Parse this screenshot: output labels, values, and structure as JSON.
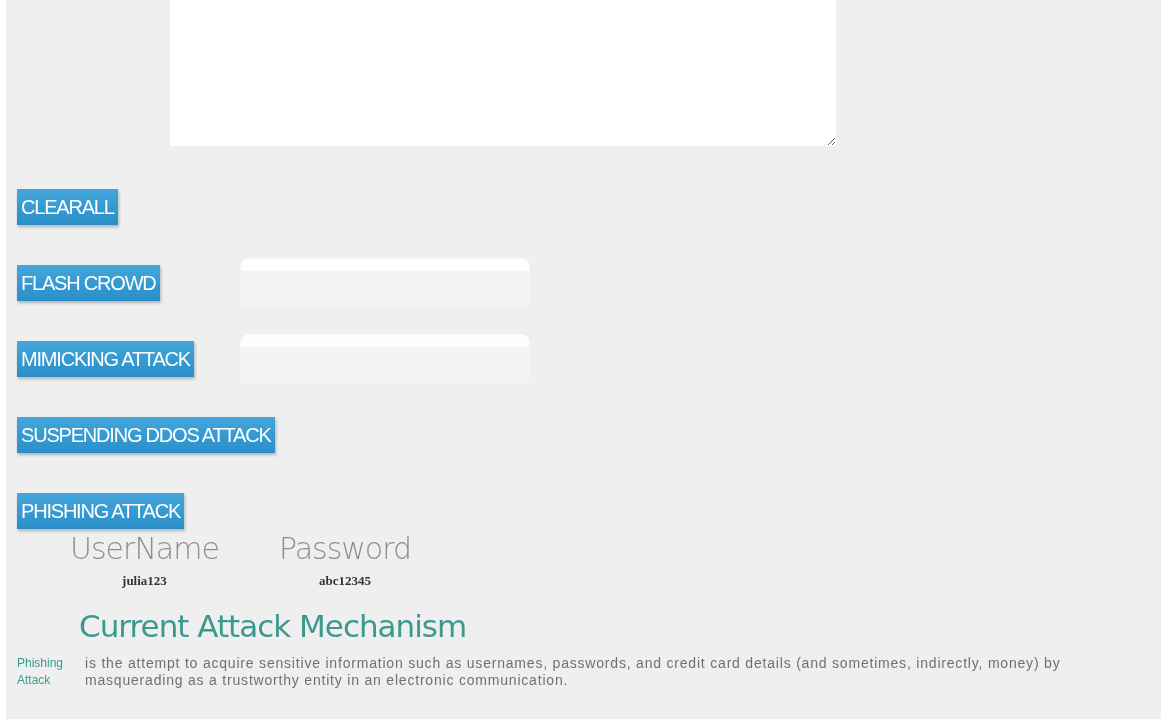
{
  "buttons": [
    {
      "label": "CLEARALL",
      "has_field": false
    },
    {
      "label": "FLASH CROWD",
      "has_field": true
    },
    {
      "label": "MIMICKING ATTACK",
      "has_field": true
    },
    {
      "label": "SUSPENDING DDOS ATTACK",
      "has_field": false
    },
    {
      "label": "PHISHING ATTACK",
      "has_field": false
    }
  ],
  "credentials": [
    {
      "label": "UserName",
      "value": "julia123"
    },
    {
      "label": "Password",
      "value": "abc12345"
    }
  ],
  "mechanism": {
    "title": "Current Attack Mechanism",
    "term": "Phishing Attack",
    "description": "is the attempt to acquire sensitive information such as usernames, passwords, and credit card details (and sometimes, indirectly, money) by masquerading as a trustworthy entity in an electronic communication."
  }
}
